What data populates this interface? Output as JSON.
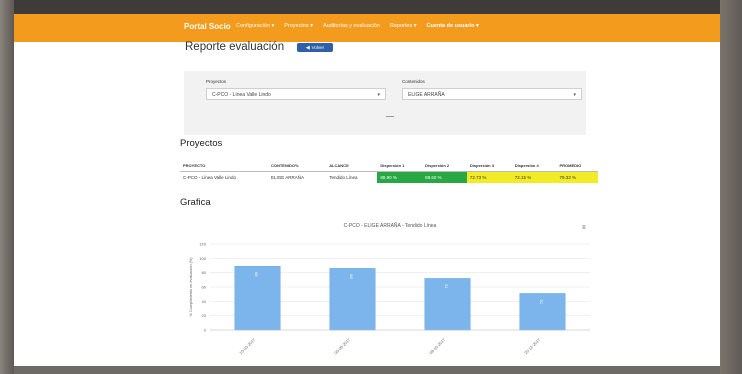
{
  "app": {
    "brand": "Portal Socio",
    "menu": [
      {
        "label": "Configuración ▾",
        "active": false
      },
      {
        "label": "Proyectos ▾",
        "active": false
      },
      {
        "label": "Auditorías y evaluación",
        "active": false
      },
      {
        "label": "Reportes ▾",
        "active": false
      },
      {
        "label": "Cuenta de usuario ▾",
        "active": true
      }
    ]
  },
  "page": {
    "title": "Reporte evaluación",
    "back_label": "Volver"
  },
  "filters": {
    "proyectos_label": "Proyectos",
    "proyectos_value": "C-PCO - Línea Valle Lindo",
    "contenidos_label": "Contenidos",
    "contenidos_value": "ELIGE ARRAÑA"
  },
  "projects": {
    "title": "Proyectos",
    "headers": [
      "PROYECTO",
      "CONTENIDO%",
      "ALCANCE",
      "Dispersión 1",
      "Dispersión 2",
      "Dispersión 3",
      "Dispersión 4",
      "PROMEDIO"
    ],
    "rows": [
      {
        "proyecto": "C-PCO - Línea Valle Lindo",
        "contenido": "ELIGE ARRAÑA",
        "alcance": "Tendido Línea",
        "d1": "88.90 %",
        "d2": "88.60 %",
        "d3": "72.73 %",
        "d4": "72.15 %",
        "promedio": "79.33 %"
      }
    ]
  },
  "chart_section": {
    "title": "Grafica"
  },
  "colors": {
    "topbar": "#f29b1d",
    "bar": "#7cb5ec",
    "green": "#28a745",
    "yellow": "#f2ec27"
  },
  "chart_data": {
    "type": "bar",
    "title": "C-PCO - ELIGE ARRAÑA - Tendido Línea",
    "categories": [
      "10-03-2017",
      "05-06-2017",
      "08-10-2017",
      "20-12-2017"
    ],
    "values": [
      89,
      86,
      72,
      51
    ],
    "ylabel": "% Cumplimiento en evaluación (%)",
    "ylim": [
      0,
      120
    ],
    "yticks": [
      0,
      20,
      40,
      60,
      80,
      100,
      120
    ],
    "grid": true,
    "legend": "none"
  }
}
